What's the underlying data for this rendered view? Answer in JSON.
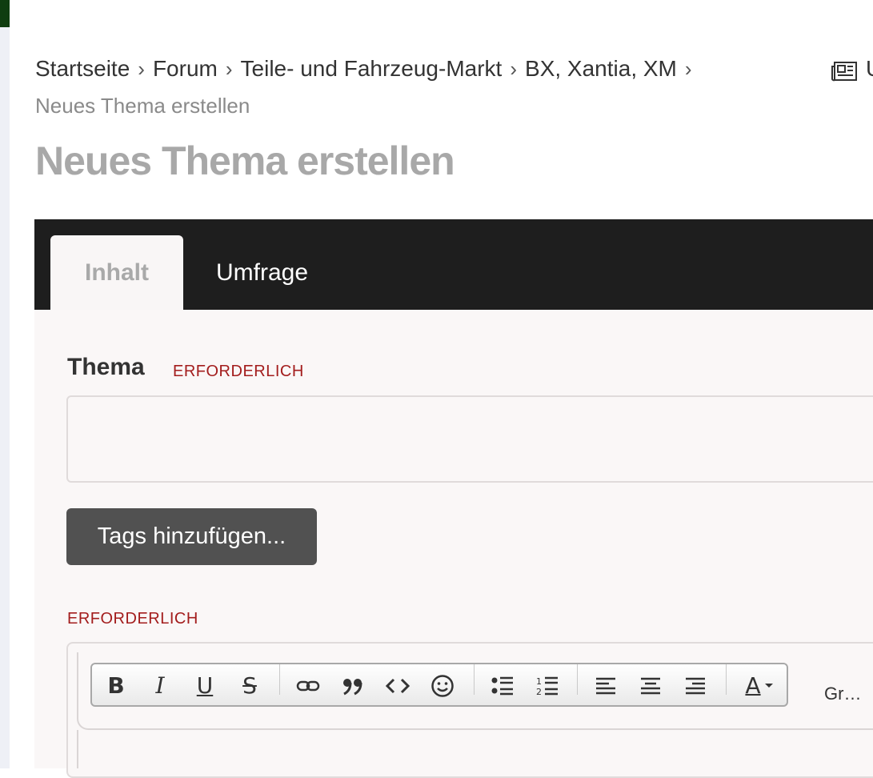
{
  "breadcrumb": {
    "items": [
      "Startseite",
      "Forum",
      "Teile- und Fahrzeug-Markt",
      "BX, Xantia, XM"
    ],
    "separator": ">",
    "current": "Neues Thema erstellen",
    "right_link_label": "U"
  },
  "page": {
    "title": "Neues Thema erstellen"
  },
  "tabs": [
    {
      "label": "Inhalt",
      "active": true
    },
    {
      "label": "Umfrage",
      "active": false
    }
  ],
  "form": {
    "thema_label": "Thema",
    "required_label": "ERFORDERLICH",
    "thema_value": "",
    "tags_button": "Tags hinzufügen...",
    "content_required_label": "ERFORDERLICH"
  },
  "editor": {
    "toolbar_icons": [
      "bold-icon",
      "italic-icon",
      "underline-icon",
      "strikethrough-icon",
      "link-icon",
      "quote-icon",
      "code-icon",
      "emoji-icon",
      "bullet-list-icon",
      "numbered-list-icon",
      "align-left-icon",
      "align-center-icon",
      "align-right-icon",
      "text-color-icon"
    ],
    "bold_glyph": "B",
    "italic_glyph": "I",
    "underline_glyph": "U",
    "strike_glyph": "S",
    "color_glyph": "A",
    "font_size_label": "Gr…"
  },
  "colors": {
    "tabbar_bg": "#1e1e1e",
    "required_red": "#a31d1d",
    "button_bg": "#515151",
    "title_gray": "#a8a8a8"
  }
}
